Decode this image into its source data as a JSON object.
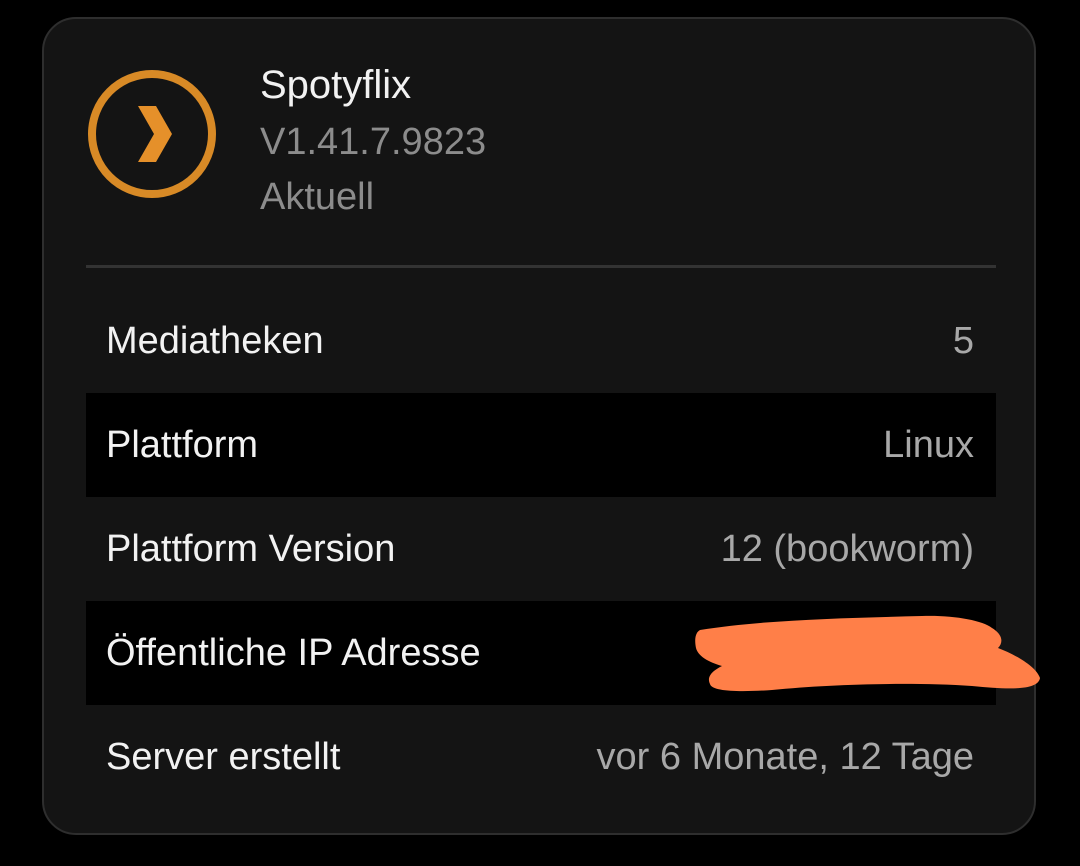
{
  "app": {
    "name": "Spotyflix",
    "version": "V1.41.7.9823",
    "status": "Aktuell",
    "logo_icon": "chevron-right-circle-icon",
    "accent_color": "#e5902a"
  },
  "info_rows": [
    {
      "label": "Mediatheken",
      "value": "5"
    },
    {
      "label": "Plattform",
      "value": "Linux"
    },
    {
      "label": "Plattform Version",
      "value": "12 (bookworm)"
    },
    {
      "label": "Öffentliche IP Adresse",
      "value": ""
    },
    {
      "label": "Server erstellt",
      "value": "vor 6 Monate, 12 Tage"
    }
  ],
  "redaction": {
    "color": "#ff7f48"
  }
}
